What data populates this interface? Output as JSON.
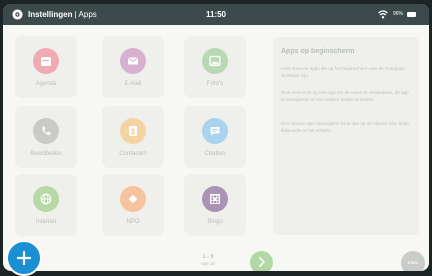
{
  "status": {
    "app_title": "Instellingen",
    "separator": "|",
    "breadcrumb": "Apps",
    "time": "11:50",
    "battery": "96%"
  },
  "apps": [
    {
      "label": "Agenda",
      "icon": "calendar-icon",
      "color": "#f0aab2"
    },
    {
      "label": "E-mail",
      "icon": "mail-icon",
      "color": "#d8b1d1"
    },
    {
      "label": "Foto's",
      "icon": "photo-icon",
      "color": "#b9d9b5"
    },
    {
      "label": "Beeldbellen",
      "icon": "phone-icon",
      "color": "#c9cbc9"
    },
    {
      "label": "Contacten",
      "icon": "contacts-icon",
      "color": "#f5d4a3"
    },
    {
      "label": "Chatten",
      "icon": "chat-icon",
      "color": "#a9d3ee"
    },
    {
      "label": "Internet",
      "icon": "globe-icon",
      "color": "#b7d9a8"
    },
    {
      "label": "NPO",
      "icon": "npo-icon",
      "color": "#f6c39e"
    },
    {
      "label": "Bingo",
      "icon": "bingo-icon",
      "color": "#ab93b5"
    }
  ],
  "panel": {
    "title": "Apps op beginscherm",
    "p1": "Leks staat de apps die op het beginscherm van de Compaan zichtbaar zijn.",
    "p2": "Druk even licht op een app om de naam te veranderen, de app te verwijderen of een andere positie te kiezen.",
    "p3": "Een nieuwe app toevoegen? Druk dan op de blauwe plus knop linksonder in het scherm."
  },
  "pager": {
    "range": "1 - 9",
    "of": "van 10"
  },
  "done_label": "Klaar",
  "colors": {
    "accent": "#1a8fd1",
    "next": "#b2d9a5",
    "statusbar": "#3d4a4c"
  }
}
